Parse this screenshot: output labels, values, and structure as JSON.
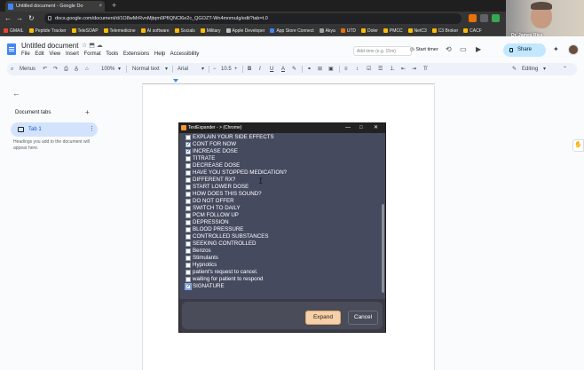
{
  "browser": {
    "tab_title": "Untitled document - Google Do",
    "tab_close": "×",
    "new_tab": "+",
    "url": "docs.google.com/document/d/1O8wMrRvnMjtqm0PfIQNCl6e2c_QGOZT-Wn4mnmuIg/edit?tab=t.0",
    "minimize": "–",
    "back": "←",
    "forward": "→",
    "reload": "↻",
    "bookmarks": [
      "GMAIL",
      "Peptide Tracker",
      "TeleSOAP",
      "Telemedicine",
      "AI software",
      "Socials",
      "Military",
      "Apple Developer",
      "App Store Connect",
      "Akya",
      "UTD",
      "Doler",
      "PMCC",
      "NetC3",
      "C3 Broker",
      "CACF"
    ]
  },
  "webcam": {
    "name": "Dr. James Ries"
  },
  "docs": {
    "title": "Untitled document",
    "title_icons": "☆ ⬒ ☁",
    "menu": [
      "File",
      "Edit",
      "View",
      "Insert",
      "Format",
      "Tools",
      "Extensions",
      "Help",
      "Accessibility"
    ],
    "add_time_placeholder": "Add time (e.g. 15m)",
    "start_timer": "Start timer",
    "share": "Share",
    "toolbar": {
      "menus": "Menus",
      "zoom": "100%",
      "style": "Normal text",
      "font": "Arial",
      "font_size": "10.5",
      "minus": "−",
      "plus": "+",
      "bold": "B",
      "italic": "I",
      "underline": "U",
      "text_color": "A",
      "mode": "Editing"
    },
    "sidebar": {
      "back": "←",
      "heading": "Document tabs",
      "add": "+",
      "tab_label": "Tab 1",
      "tab_more": "⋮",
      "hint": "Headings you add to the document will appear here."
    },
    "side_tab_icon": "✋"
  },
  "dialog": {
    "title": "TextExpander - > (Chrome)",
    "minimize": "—",
    "maximize": "□",
    "close": "✕",
    "items": [
      {
        "label": "EXPLAIN YOUR SIDE EFFECTS",
        "checked": false
      },
      {
        "label": "CONT FOR NOW",
        "checked": true
      },
      {
        "label": "INCREASE DOSE",
        "checked": true
      },
      {
        "label": "TITRATE",
        "checked": false
      },
      {
        "label": "DECREASE DOSE",
        "checked": false
      },
      {
        "label": "HAVE YOU STOPPED MEDICATION?",
        "checked": false
      },
      {
        "label": "DIFFERENT RX?",
        "checked": false
      },
      {
        "label": "START LOWER DOSE",
        "checked": false
      },
      {
        "label": "HOW DOES THIS SOUND?",
        "checked": false
      },
      {
        "label": "DO NOT OFFER",
        "checked": false
      },
      {
        "label": "SWITCH TO DAILY",
        "checked": false
      },
      {
        "label": "PCM FOLLOW UP",
        "checked": false
      },
      {
        "label": "DEPRESSION",
        "checked": false
      },
      {
        "label": "BLOOD PRESSURE",
        "checked": false
      },
      {
        "label": "CONTROLLED SUBSTANCES",
        "checked": false
      },
      {
        "label": "SEEKING CONTROLLED",
        "checked": false
      },
      {
        "label": "Benzos",
        "checked": false
      },
      {
        "label": "Stimulants",
        "checked": false
      },
      {
        "label": "Hypnotics",
        "checked": false
      },
      {
        "label": "patient's request to cancel.",
        "checked": false
      },
      {
        "label": "waiting for patient to respond",
        "checked": false
      },
      {
        "label": "SIGNATURE",
        "checked": true
      }
    ],
    "expand": "Expand",
    "cancel": "Cancel"
  },
  "colors": {
    "accent_blue": "#1a73e8",
    "share_bg": "#c2e7ff",
    "dialog_bg": "#464a5f",
    "expand_bg": "#f5d0a8"
  }
}
